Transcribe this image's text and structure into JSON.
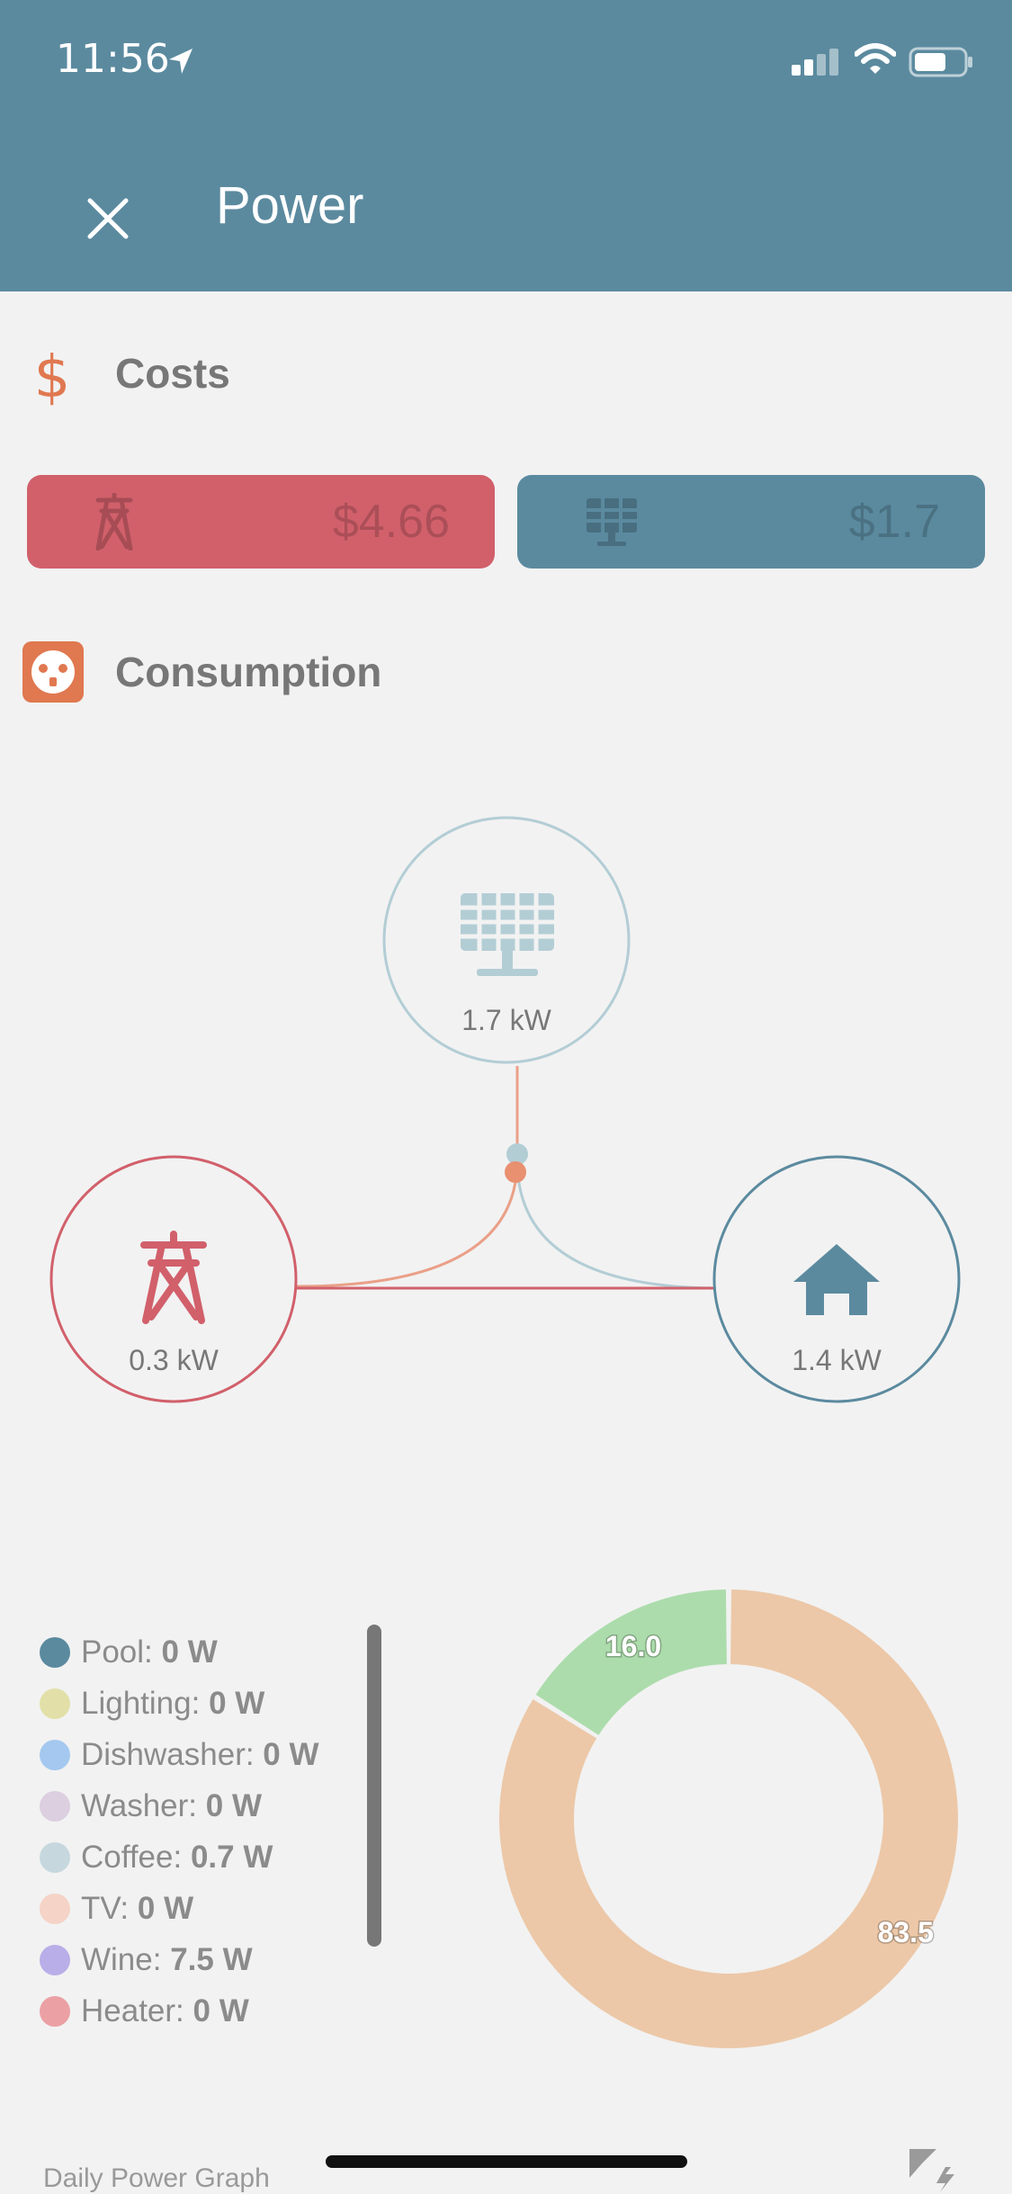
{
  "status_bar": {
    "time": "11:56"
  },
  "header": {
    "title": "Power"
  },
  "costs": {
    "title": "Costs",
    "grid_cost": "$4.66",
    "solar_cost": "$1.7"
  },
  "consumption": {
    "title": "Consumption",
    "solar_power": "1.7 kW",
    "grid_power": "0.3 kW",
    "home_power": "1.4 kW"
  },
  "legend": [
    {
      "name": "Pool:",
      "value": "0 W",
      "color": "#5b8a9f"
    },
    {
      "name": "Lighting:",
      "value": "0 W",
      "color": "#e2e0a8"
    },
    {
      "name": "Dishwasher:",
      "value": "0 W",
      "color": "#a4c8ef"
    },
    {
      "name": "Washer:",
      "value": "0 W",
      "color": "#dccfe0"
    },
    {
      "name": "Coffee:",
      "value": "0.7 W",
      "color": "#c6d8de"
    },
    {
      "name": "TV:",
      "value": "0 W",
      "color": "#f5d3c6"
    },
    {
      "name": "Wine:",
      "value": "7.5 W",
      "color": "#b9aee8"
    },
    {
      "name": "Heater:",
      "value": "0 W",
      "color": "#eba0a4"
    }
  ],
  "chart_data": {
    "type": "pie",
    "categories": [
      "",
      ""
    ],
    "values": [
      83.5,
      16.0
    ],
    "colors": [
      "#ecc8a8",
      "#acdcac"
    ],
    "labels": [
      "83.5",
      "16.0"
    ]
  },
  "footer": {
    "title": "Daily Power Graph"
  },
  "colors": {
    "header": "#5b8a9f",
    "grid": "#d1606b",
    "solar": "#b3cdd5",
    "home": "#5b8a9f",
    "accent": "#e07850"
  }
}
